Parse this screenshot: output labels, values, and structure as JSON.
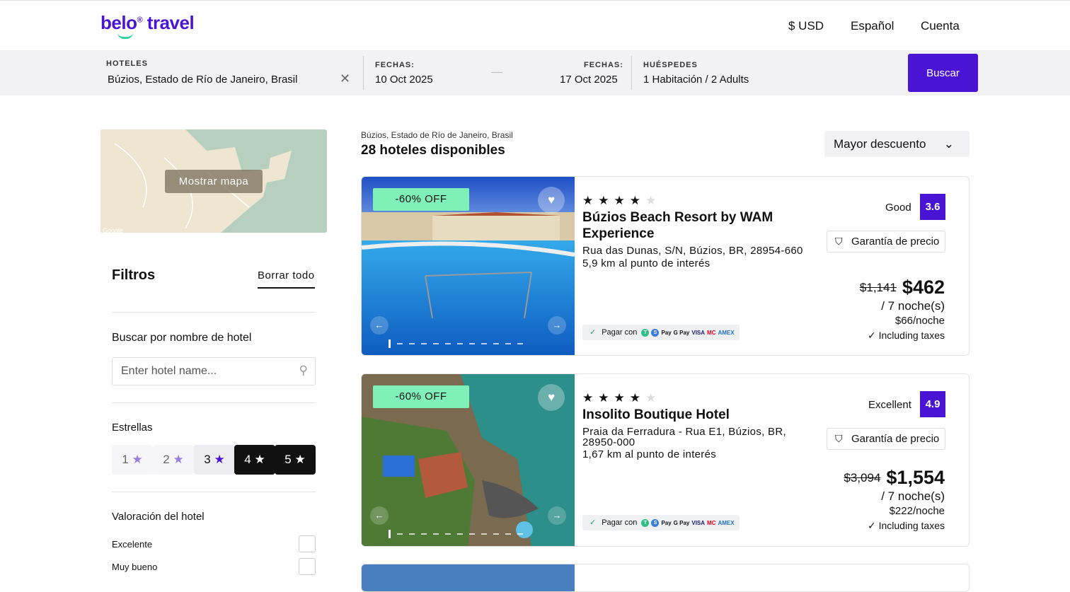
{
  "brand": {
    "name": "belo",
    "suffix": "travel",
    "mark": "®"
  },
  "nav": {
    "currency": "$ USD",
    "language": "Español",
    "account": "Cuenta"
  },
  "search": {
    "hotels_label": "HOTELES",
    "destination": "Búzios, Estado de Río de Janeiro, Brasil",
    "checkin_label": "FECHAS:",
    "checkin": "10 Oct 2025",
    "checkout_label": "FECHAS:",
    "checkout": "17 Oct 2025",
    "guests_label": "HUÉSPEDES",
    "guests": "1 Habitación / 2 Adults",
    "button": "Buscar"
  },
  "map": {
    "button": "Mostrar mapa",
    "attribution": "Google"
  },
  "filters": {
    "title": "Filtros",
    "clear": "Borrar todo",
    "hotel_name_label": "Buscar por nombre de hotel",
    "hotel_name_placeholder": "Enter hotel name...",
    "stars_label": "Estrellas",
    "stars": [
      {
        "label": "1",
        "state": "light"
      },
      {
        "label": "2",
        "state": "light"
      },
      {
        "label": "3",
        "state": "medium"
      },
      {
        "label": "4",
        "state": "dark"
      },
      {
        "label": "5",
        "state": "dark"
      }
    ],
    "rating_label": "Valoración del hotel",
    "ratings": [
      "Excelente",
      "Muy bueno"
    ]
  },
  "results": {
    "location": "Búzios, Estado de Río de Janeiro, Brasil",
    "count": "28 hoteles disponibles",
    "sort": "Mayor descuento"
  },
  "hotels": [
    {
      "badge": "-60% OFF",
      "stars": 4,
      "name": "Búzios Beach Resort by WAM Experience",
      "address": "Rua das Dunas, S/N, Búzios, BR, 28954-660",
      "distance": "5,9 km al punto de interés",
      "rating_word": "Good",
      "rating": "3.6",
      "guarantee": "Garantía de precio",
      "old_price": "$1,141",
      "price": "$462",
      "nights": "/ 7 noche(s)",
      "per_night": "$66/noche",
      "taxes": "Including taxes",
      "pay_label": "Pagar con"
    },
    {
      "badge": "-60% OFF",
      "stars": 4,
      "name": "Insolito Boutique Hotel",
      "address": "Praia da Ferradura - Rua E1, Búzios, BR, 28950-000",
      "distance": "1,67 km al punto de interés",
      "rating_word": "Excellent",
      "rating": "4.9",
      "guarantee": "Garantía de precio",
      "old_price": "$3,094",
      "price": "$1,554",
      "nights": "/ 7 noche(s)",
      "per_night": "$222/noche",
      "taxes": "Including taxes",
      "pay_label": "Pagar con"
    }
  ],
  "payment_methods": [
    "T",
    "S",
    "Pay",
    "G Pay",
    "VISA",
    "MC",
    "AMEX"
  ],
  "colors": {
    "accent": "#4a14d4",
    "badge": "#7ff0b8",
    "bar": "#f2f2f5"
  }
}
